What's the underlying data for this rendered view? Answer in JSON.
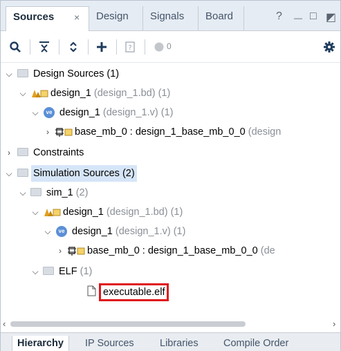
{
  "tabs": {
    "sources": "Sources",
    "close_glyph": "×",
    "design": "Design",
    "signals": "Signals",
    "board": "Board",
    "help": "?",
    "minimize": "—",
    "restore": "□",
    "float": "◩"
  },
  "toolbar": {
    "badge_count": "0"
  },
  "tree": {
    "design_sources": {
      "label": "Design Sources",
      "count": "(1)"
    },
    "ds_bd": {
      "label": "design_1",
      "sub": "(design_1.bd) (1)"
    },
    "ds_v": {
      "label": "design_1",
      "sub": "(design_1.v) (1)"
    },
    "ds_mb": {
      "label": "base_mb_0 : design_1_base_mb_0_0",
      "sub": "(design"
    },
    "constraints": {
      "label": "Constraints"
    },
    "sim_sources": {
      "label": "Simulation Sources (2)"
    },
    "sim_1": {
      "label": "sim_1",
      "sub": "(2)"
    },
    "ss_bd": {
      "label": "design_1",
      "sub": "(design_1.bd) (1)"
    },
    "ss_v": {
      "label": "design_1",
      "sub": "(design_1.v) (1)"
    },
    "ss_mb": {
      "label": "base_mb_0 : design_1_base_mb_0_0",
      "sub": "(de"
    },
    "elf": {
      "label": "ELF",
      "sub": "(1)"
    },
    "elf_file": {
      "label": "executable.elf"
    }
  },
  "bottom_tabs": [
    "Hierarchy",
    "IP Sources",
    "Libraries",
    "Compile Order"
  ],
  "colors": {
    "selection_box": "#e0161a",
    "highlight": "#d6e5f8",
    "accent_icon": "#1f3b5c"
  }
}
